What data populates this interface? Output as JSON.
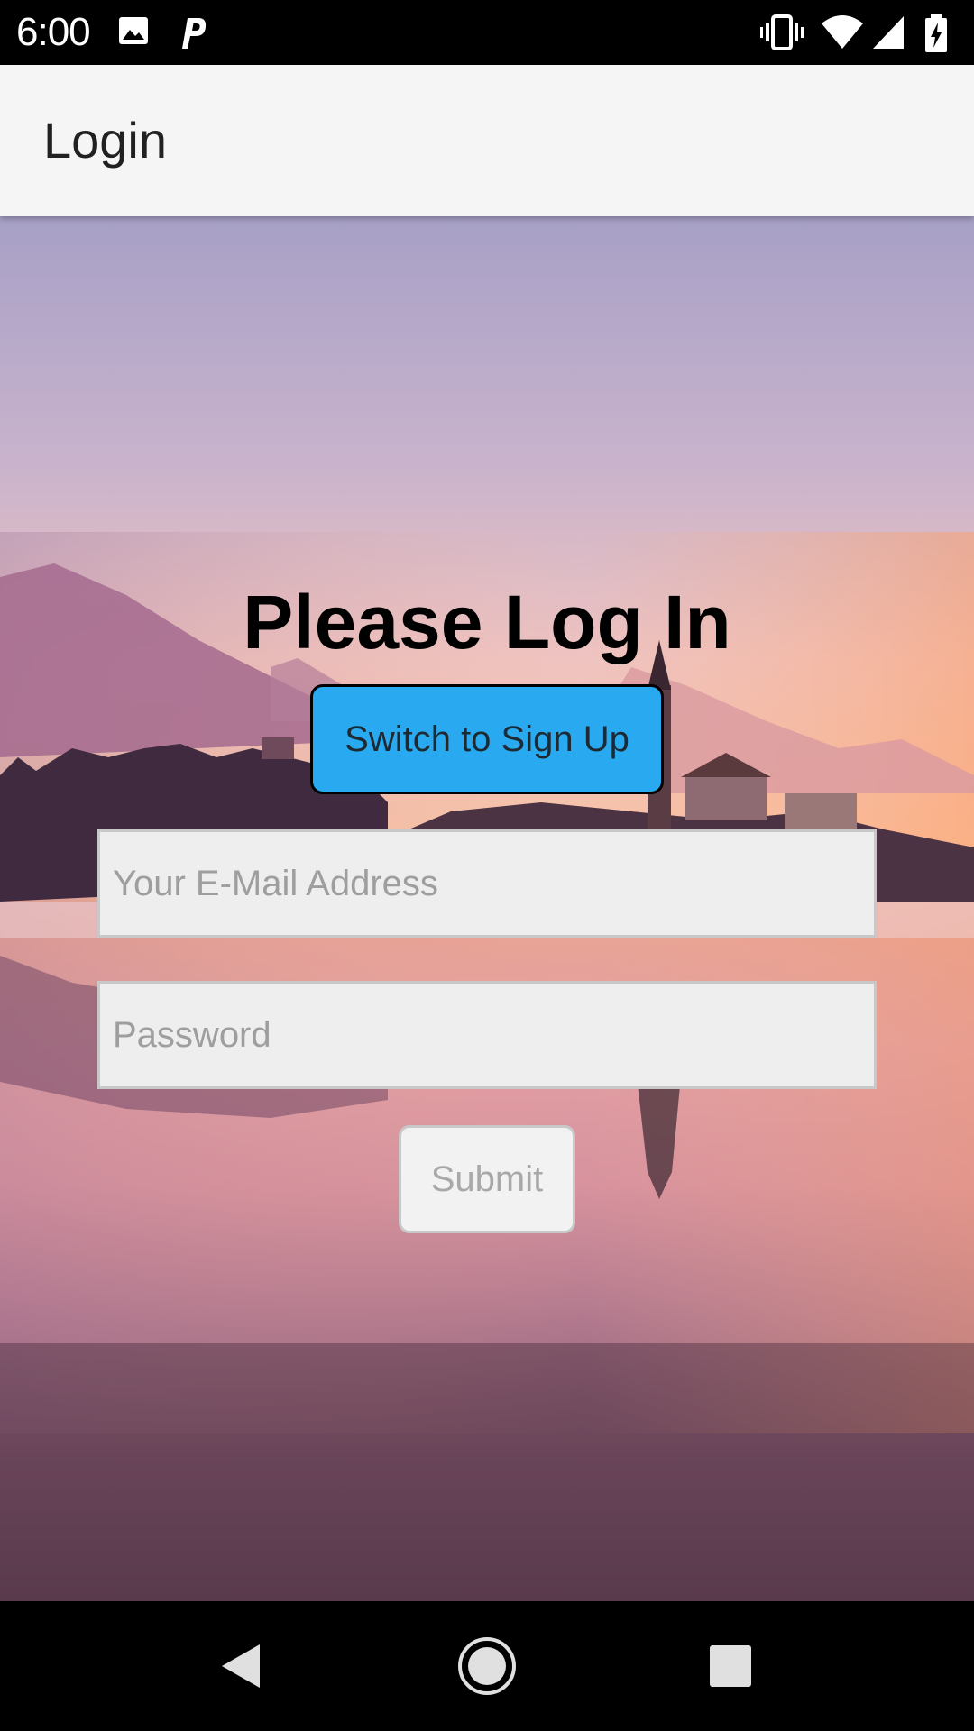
{
  "status_bar": {
    "time": "6:00",
    "left_icons": [
      "image-icon",
      "parking-app-icon"
    ],
    "right_icons": [
      "vibrate-icon",
      "wifi-icon",
      "signal-icon",
      "battery-charging-icon"
    ]
  },
  "app_bar": {
    "title": "Login"
  },
  "main": {
    "heading": "Please Log In",
    "switch_label": "Switch to Sign Up",
    "email_placeholder": "Your E-Mail Address",
    "email_value": "",
    "password_placeholder": "Password",
    "password_value": "",
    "submit_label": "Submit"
  },
  "nav_bar": {
    "buttons": [
      "back-icon",
      "home-icon",
      "recents-icon"
    ]
  },
  "colors": {
    "switch_button_bg": "#29aaf0",
    "app_bar_bg": "#f5f5f5",
    "input_bg": "#eeeeee",
    "submit_text": "#a8a8a8"
  }
}
